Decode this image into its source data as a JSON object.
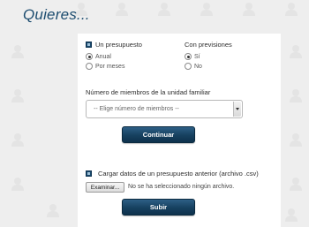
{
  "page": {
    "title": "Quieres..."
  },
  "budget_section": {
    "heading": "Un presupuesto",
    "options": [
      {
        "label": "Anual",
        "selected": true
      },
      {
        "label": "Por meses",
        "selected": false
      }
    ]
  },
  "forecast_section": {
    "heading": "Con previsiones",
    "options": [
      {
        "label": "Sí",
        "selected": true
      },
      {
        "label": "No",
        "selected": false
      }
    ]
  },
  "family_members": {
    "label": "Número de miembros de la unidad familiar",
    "selected_value": "-- Elige número de miembros --"
  },
  "continue_button": {
    "label": "Continuar"
  },
  "upload_section": {
    "heading": "Cargar datos de un presupuesto anterior (archivo .csv)",
    "browse_label": "Examinar...",
    "file_status": "No se ha seleccionado ningún archivo."
  },
  "submit_button": {
    "label": "Subir"
  },
  "colors": {
    "accent": "#1b4b6e",
    "button": "#16405f",
    "background": "#eeeeee",
    "panel": "#ffffff"
  }
}
